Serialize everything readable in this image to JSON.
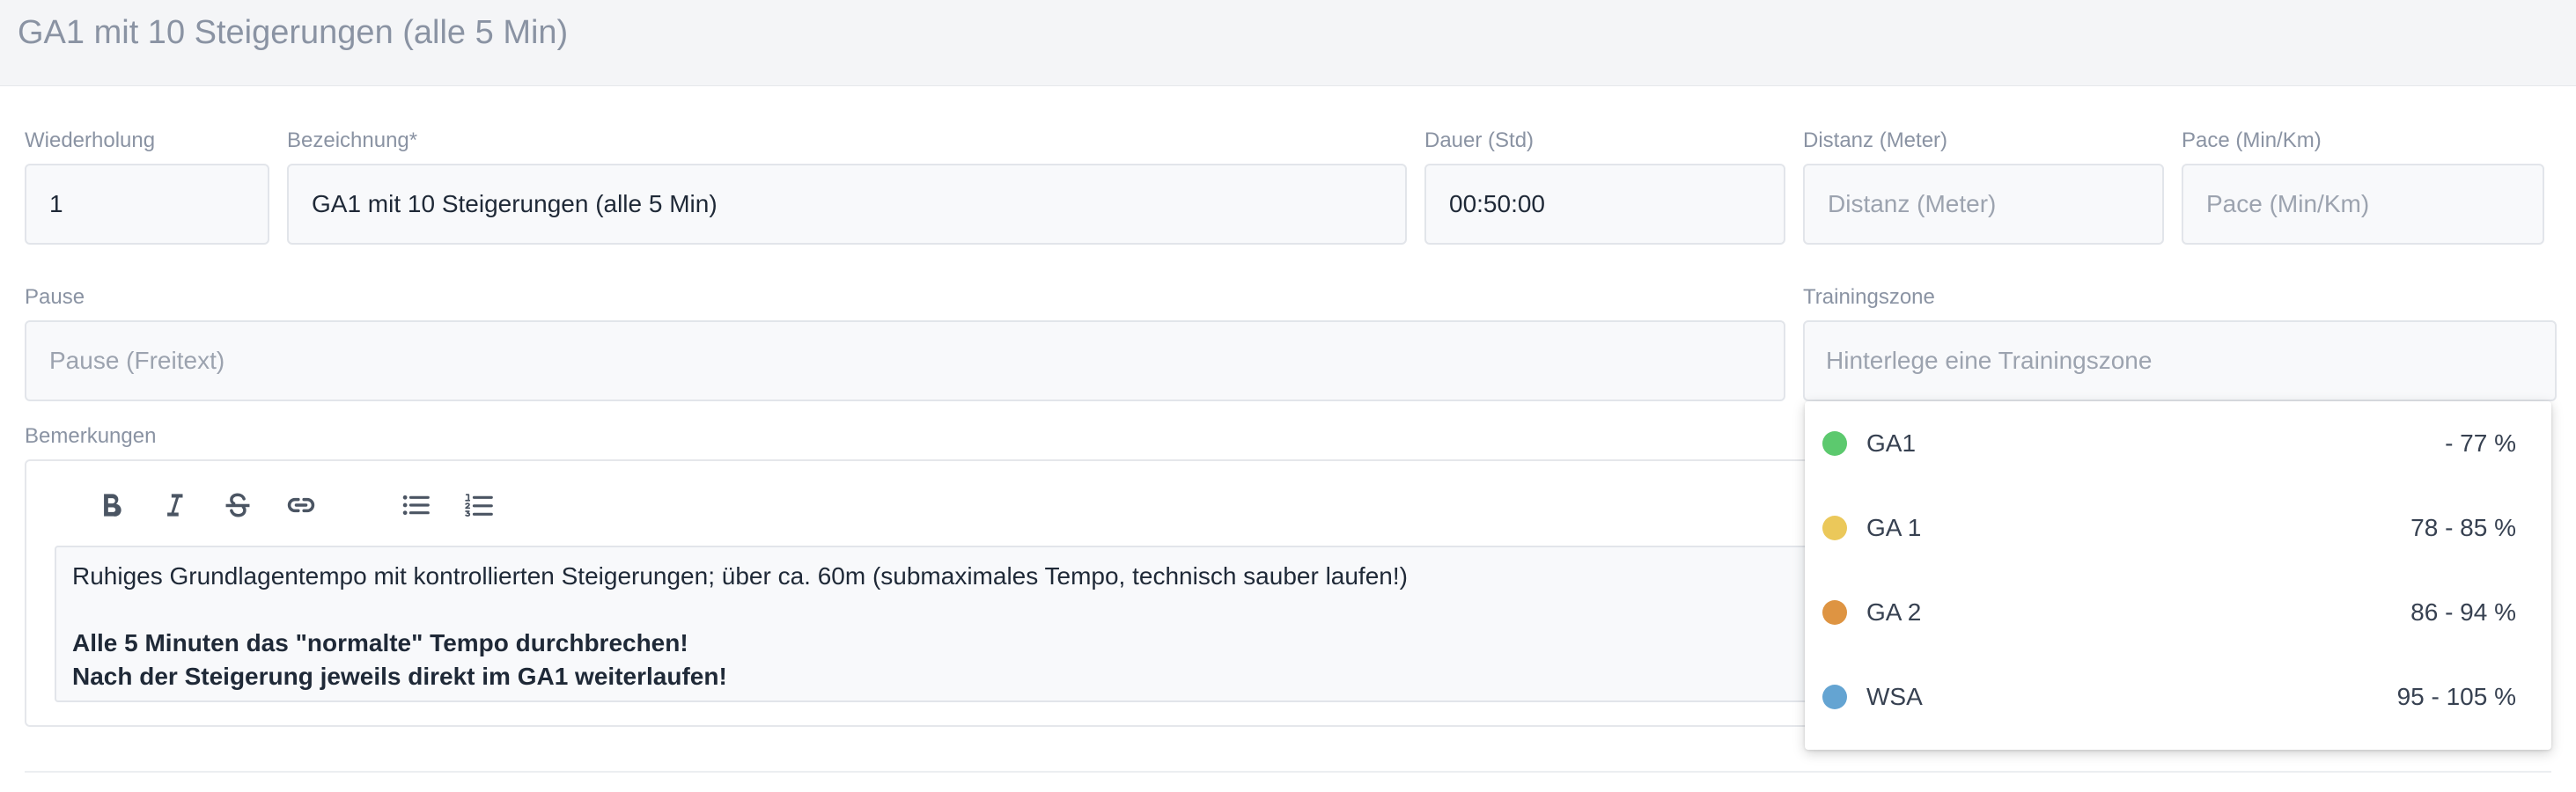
{
  "header": {
    "title": "GA1 mit 10 Steigerungen (alle 5 Min)"
  },
  "form": {
    "wiederholung": {
      "label": "Wiederholung",
      "value": "1",
      "placeholder": ""
    },
    "bezeichnung": {
      "label": "Bezeichnung*",
      "value": "GA1 mit 10 Steigerungen (alle 5 Min)",
      "placeholder": ""
    },
    "dauer": {
      "label": "Dauer (Std)",
      "value": "00:50:00",
      "placeholder": ""
    },
    "distanz": {
      "label": "Distanz (Meter)",
      "value": "",
      "placeholder": "Distanz (Meter)"
    },
    "pace": {
      "label": "Pace (Min/Km)",
      "value": "",
      "placeholder": "Pace (Min/Km)"
    },
    "pause": {
      "label": "Pause",
      "value": "",
      "placeholder": "Pause (Freitext)"
    },
    "trainingszone": {
      "label": "Trainingszone",
      "placeholder": "Hinterlege eine Trainingszone"
    },
    "bemerkungen": {
      "label": "Bemerkungen",
      "line1": "Ruhiges Grundlagentempo mit kontrollierten Steigerungen; über ca. 60m (submaximales Tempo, technisch sauber laufen!)",
      "line2": "Alle 5 Minuten das \"normalte\" Tempo durchbrechen!",
      "line3": "Nach der Steigerung jeweils direkt im GA1 weiterlaufen!"
    }
  },
  "toolbar": {
    "icons": [
      "bold-icon",
      "italic-icon",
      "strikethrough-icon",
      "link-icon",
      "bullet-list-icon",
      "numbered-list-icon"
    ]
  },
  "zones": [
    {
      "name": "GA1",
      "range": "- 77 %",
      "color": "#5cc96e"
    },
    {
      "name": "GA 1",
      "range": "78 - 85 %",
      "color": "#ebc85a"
    },
    {
      "name": "GA 2",
      "range": "86 - 94 %",
      "color": "#de9442"
    },
    {
      "name": "WSA",
      "range": "95 - 105 %",
      "color": "#64a4d2"
    }
  ]
}
